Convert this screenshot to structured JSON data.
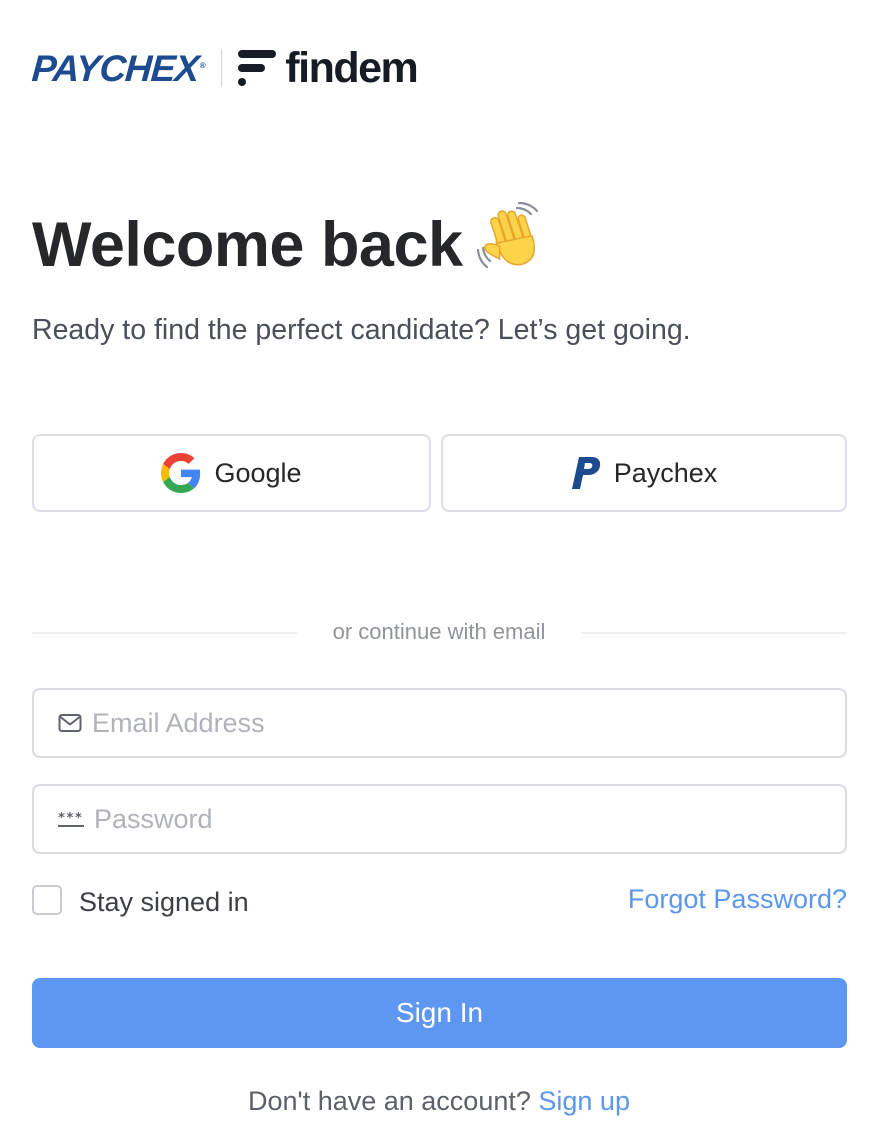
{
  "brand": {
    "paychex_logo": "PAYCHEX",
    "reg_mark": "®",
    "findem_logo": "findem",
    "colors": {
      "paychex_blue": "#1e4b8f",
      "findem_dark": "#171b24"
    }
  },
  "header": {
    "title": "Welcome back",
    "title_icon": "waving-hand-icon",
    "subtitle": "Ready to find the perfect candidate? Let’s get going."
  },
  "sso": {
    "google_label": "Google",
    "google_icon": "google-icon",
    "paychex_label": "Paychex",
    "paychex_icon": "paychex-p-icon"
  },
  "divider": {
    "text": "or continue with email"
  },
  "form": {
    "email": {
      "placeholder": "Email Address",
      "value": "",
      "icon": "mail-icon"
    },
    "password": {
      "placeholder": "Password",
      "value": "",
      "icon": "password-dots-icon"
    },
    "stay_signed_in": {
      "label": "Stay signed in",
      "checked": false
    },
    "forgot_password": "Forgot Password?",
    "submit_label": "Sign In"
  },
  "footer": {
    "prompt": "Don't have an account?",
    "signup_label": "Sign up"
  },
  "colors": {
    "accent": "#5d97f2",
    "link": "#5b97ef",
    "text": "#26272b",
    "muted": "#90949c",
    "border": "#dcdfe5"
  }
}
